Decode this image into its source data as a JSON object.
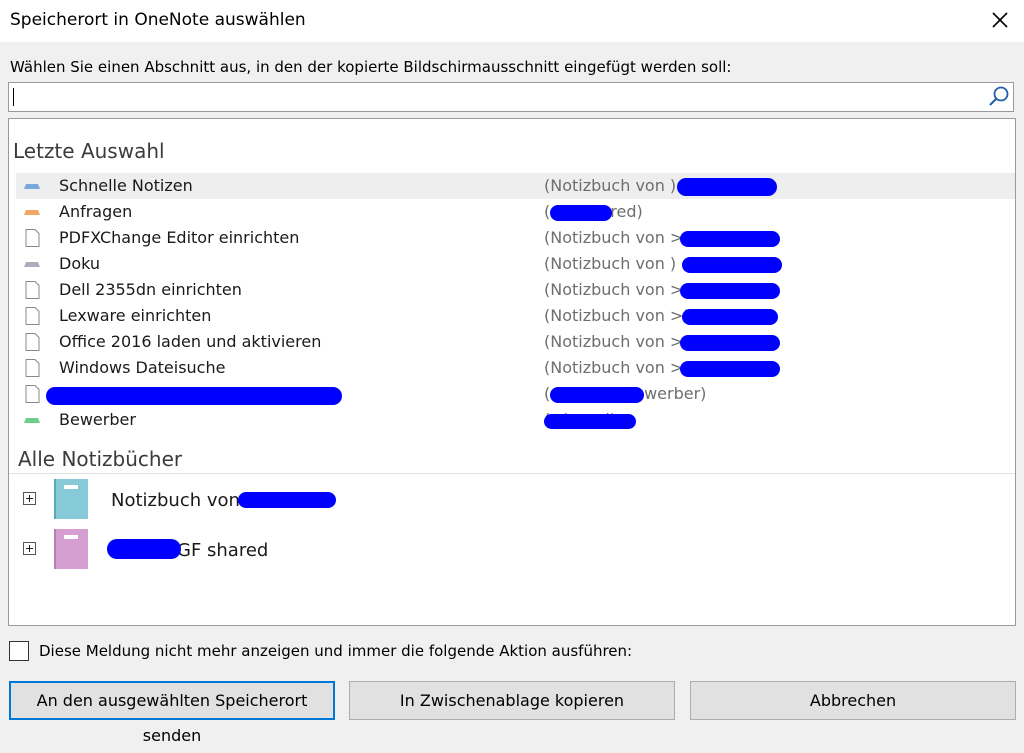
{
  "dialog": {
    "title": "Speicherort in OneNote auswählen",
    "instruction": "Wählen Sie einen Abschnitt aus, in den der kopierte Bildschirmausschnitt eingefügt werden soll:",
    "search": {
      "value": "",
      "placeholder": ""
    }
  },
  "recent": {
    "heading": "Letzte Auswahl",
    "items": [
      {
        "name": "Schnelle Notizen",
        "location": "(Notizbuch von )",
        "icon": "section-tab-blue-icon",
        "selected": true
      },
      {
        "name": "Anfragen",
        "location": "(  GF shared)",
        "icon": "section-tab-orange-icon"
      },
      {
        "name": "PDFXChange Editor einrichten",
        "location": "(Notizbuch von >Doku)",
        "icon": "page-icon"
      },
      {
        "name": "Doku",
        "location": "(Notizbuch von )",
        "icon": "section-tab-gray-icon"
      },
      {
        "name": "Dell 2355dn einrichten",
        "location": "(Notizbuch von >Doku)",
        "icon": "page-icon"
      },
      {
        "name": "Lexware einrichten",
        "location": "(Notizbuch von >Doku)",
        "icon": "page-icon"
      },
      {
        "name": "Office 2016 laden und aktivieren",
        "location": "(Notizbuch von >Doku)",
        "icon": "page-icon"
      },
      {
        "name": "Windows Dateisuche",
        "location": "(Notizbuch von >Doku)",
        "icon": "page-icon"
      },
      {
        "name": "",
        "location": "( shared>Bewerber)",
        "icon": "page-icon"
      },
      {
        "name": "Bewerber",
        "location": "( shared)",
        "icon": "section-tab-green-icon"
      }
    ]
  },
  "notebooks": {
    "heading": "Alle Notizbücher",
    "items": [
      {
        "name": "Notizbuch von",
        "color": "#86cad8",
        "icon": "notebook-teal-icon"
      },
      {
        "name": "GF shared",
        "color": "#d59fd2",
        "icon": "notebook-purple-icon"
      }
    ]
  },
  "footer": {
    "checkbox_label": "Diese Meldung nicht mehr anzeigen und immer die folgende Aktion ausführen:",
    "checkbox_checked": false,
    "buttons": {
      "send": "An den ausgewählten Speicherort senden",
      "copy": "In Zwischenablage kopieren",
      "cancel": "Abbrechen"
    }
  },
  "colors": {
    "accent": "#0078d7",
    "section_blue": "#7aa7dd",
    "section_orange": "#f0a860",
    "section_gray": "#a9b0bb",
    "section_green": "#6ccf86",
    "redaction": "#0000ff"
  }
}
